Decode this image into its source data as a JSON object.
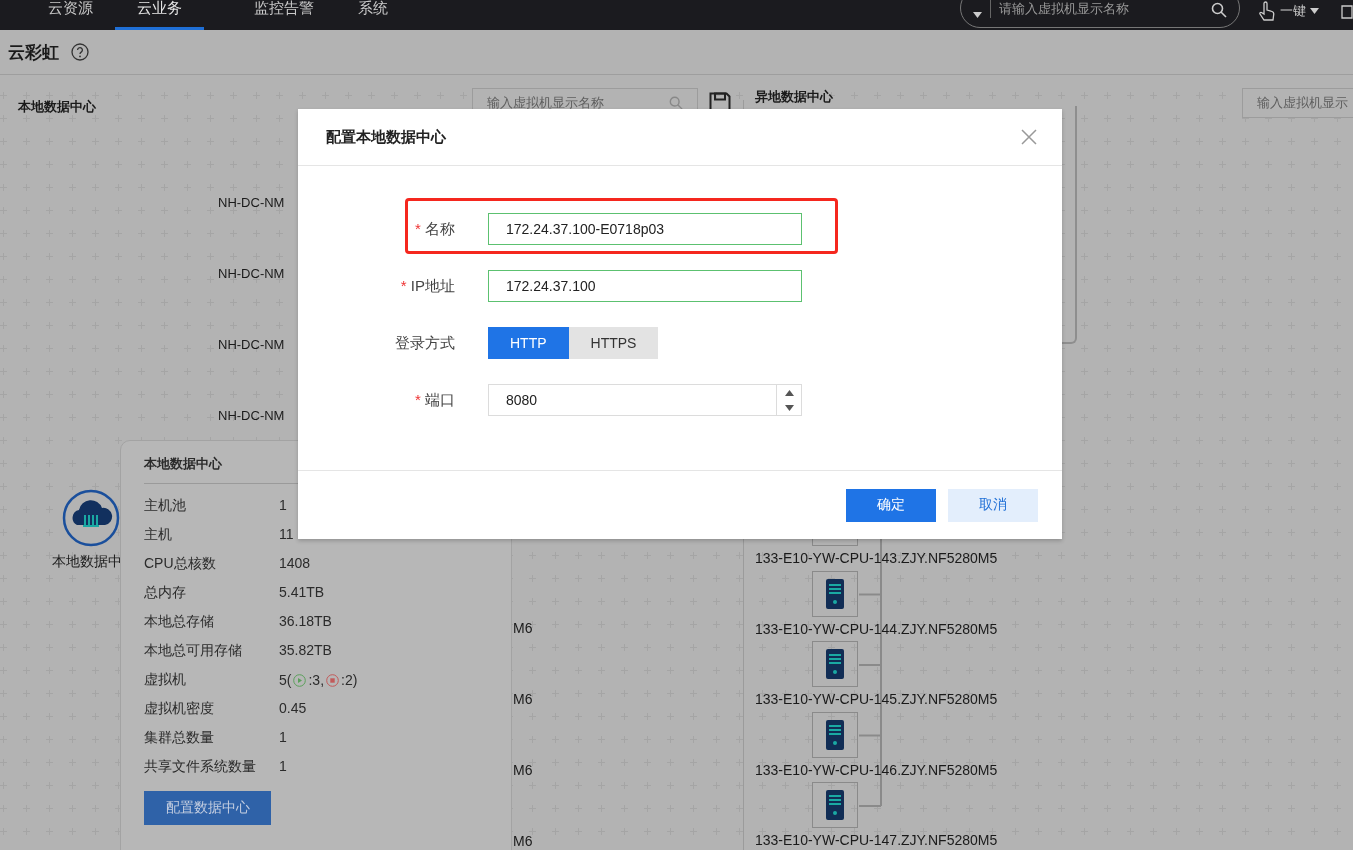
{
  "nav": {
    "items": [
      {
        "label": "云资源",
        "selected": false
      },
      {
        "label": "云业务",
        "selected": true
      },
      {
        "label": "监控告警",
        "selected": false
      },
      {
        "label": "系统",
        "selected": false
      }
    ],
    "search": {
      "placeholder": "请输入虚拟机显示名称"
    },
    "one_key": "一键"
  },
  "page": {
    "title": "云彩虹"
  },
  "local": {
    "header": "本地数据中心",
    "search_placeholder": "输入虚拟机显示名称"
  },
  "remote": {
    "header": "异地数据中心",
    "search_placeholder": "输入虚拟机显示"
  },
  "canvas": {
    "local_labels": [
      "NH-DC-NM",
      "NH-DC-NM",
      "NH-DC-NM",
      "NH-DC-NM"
    ],
    "cloud_node_label": "本地数据中",
    "label_ends": [
      "M6",
      "M6",
      "M6",
      "M6"
    ],
    "remote_hosts": [
      "133-E10-YW-CPU-143.ZJY.NF5280M5",
      "133-E10-YW-CPU-144.ZJY.NF5280M5",
      "133-E10-YW-CPU-145.ZJY.NF5280M5",
      "133-E10-YW-CPU-146.ZJY.NF5280M5",
      "133-E10-YW-CPU-147.ZJY.NF5280M5"
    ]
  },
  "info_panel": {
    "title": "本地数据中心",
    "rows": [
      {
        "kind": "text",
        "label": "主机池",
        "value": "1"
      },
      {
        "kind": "text",
        "label": "主机",
        "value": "11"
      },
      {
        "kind": "text",
        "label": "CPU总核数",
        "value": "1408"
      },
      {
        "kind": "text",
        "label": "总内存",
        "value": "5.41TB"
      },
      {
        "kind": "text",
        "label": "本地总存储",
        "value": "36.18TB"
      },
      {
        "kind": "text",
        "label": "本地总可用存储",
        "value": "35.82TB"
      },
      {
        "kind": "vm",
        "label": "虚拟机",
        "value": "5(",
        "running": ":3,",
        "stopped": ":2)"
      },
      {
        "kind": "text",
        "label": "虚拟机密度",
        "value": "0.45"
      },
      {
        "kind": "text",
        "label": "集群总数量",
        "value": "1"
      },
      {
        "kind": "text",
        "label": "共享文件系统数量",
        "value": "1"
      }
    ],
    "button": "配置数据中心"
  },
  "dialog": {
    "title": "配置本地数据中心",
    "fields": [
      {
        "kind": "text",
        "required_mark": "*",
        "label": "名称",
        "value": "172.24.37.100-E0718p03",
        "highlighted": true
      },
      {
        "kind": "text",
        "required_mark": "*",
        "label": "IP地址",
        "value": "172.24.37.100",
        "highlighted": false
      },
      {
        "kind": "toggle",
        "label": "登录方式",
        "options": [
          {
            "label": "HTTP",
            "selected": true
          },
          {
            "label": "HTTPS",
            "selected": false
          }
        ],
        "highlighted": false
      },
      {
        "kind": "number",
        "required_mark": "*",
        "label": "端口",
        "value": "8080",
        "highlighted": false
      }
    ],
    "buttons": [
      {
        "label": "确定",
        "primary": true
      },
      {
        "label": "取消",
        "primary": false
      }
    ]
  }
}
